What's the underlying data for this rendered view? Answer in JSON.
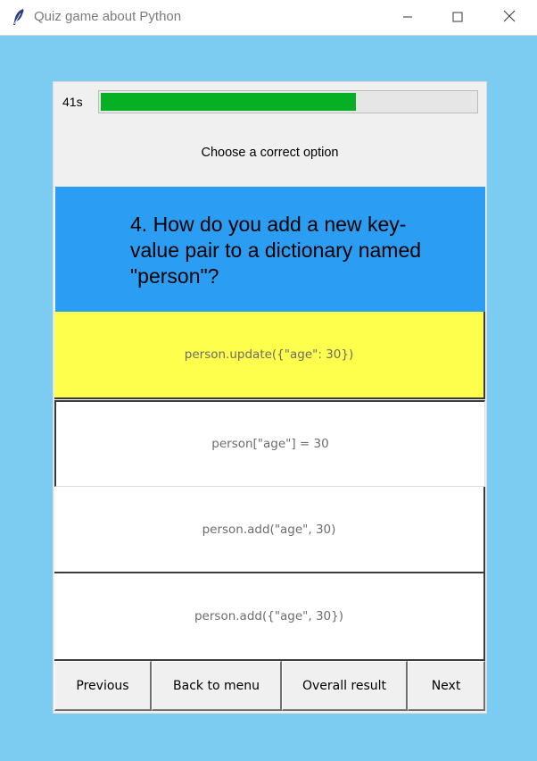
{
  "window": {
    "title": "Quiz game about Python"
  },
  "timer": {
    "label": "41s",
    "progress_fraction": 0.68
  },
  "instruction": "Choose a correct option",
  "question": {
    "text": "4. How do you add a new key-value pair to a dictionary named \"person\"?"
  },
  "options": [
    {
      "label": "person.update({\"age\": 30})",
      "selected": true
    },
    {
      "label": "person[\"age\"] = 30",
      "selected": false
    },
    {
      "label": "person.add(\"age\", 30)",
      "selected": false
    },
    {
      "label": "person.add({\"age\", 30})",
      "selected": false
    }
  ],
  "nav": {
    "previous": "Previous",
    "back_to_menu": "Back to menu",
    "overall_result": "Overall result",
    "next": "Next"
  },
  "colors": {
    "background": "#7ccbf0",
    "question_bg": "#2b9ef4",
    "selected_option": "#fefe4c",
    "progress_fill": "#06b025"
  },
  "icons": {
    "app": "feather-icon",
    "minimize": "minimize-icon",
    "maximize": "maximize-icon",
    "close": "close-icon"
  }
}
